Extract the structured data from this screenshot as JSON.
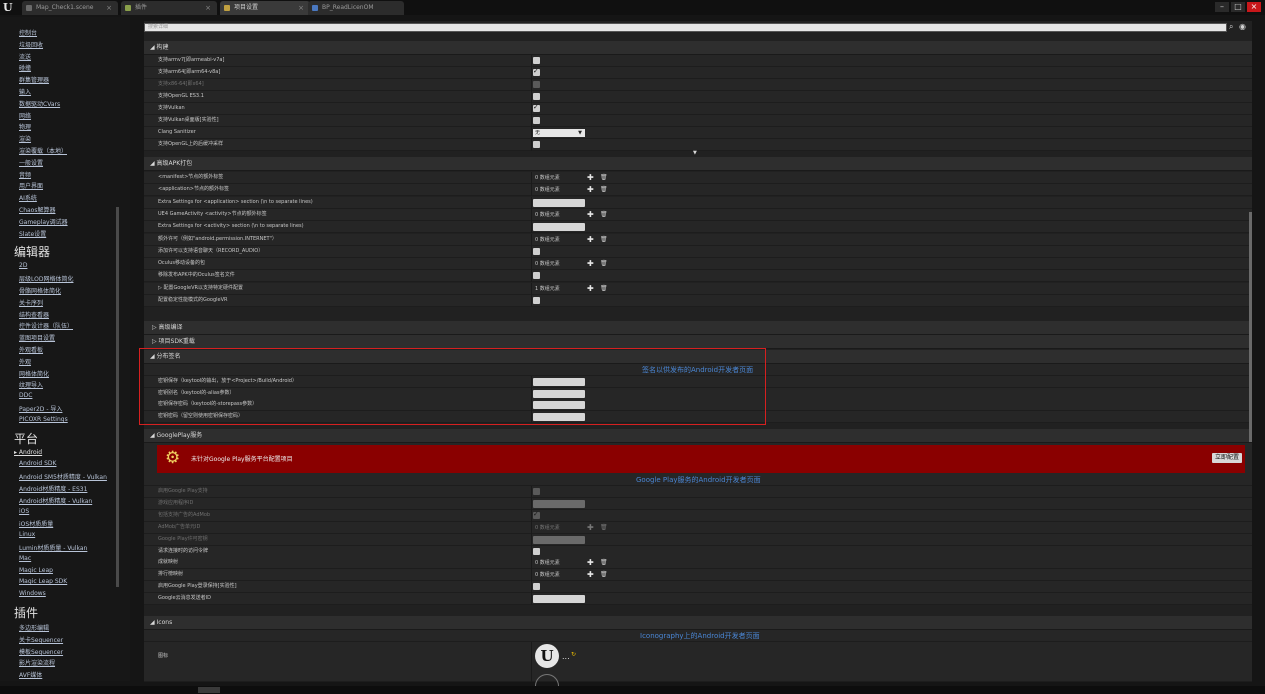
{
  "titlebar": {
    "tabs": [
      {
        "label": "Map_Check1.scene",
        "active": false
      },
      {
        "label": "插件",
        "active": false
      },
      {
        "label": "项目设置",
        "active": true
      },
      {
        "label": "BP_ReadLicenOM",
        "active": false
      }
    ],
    "close_glyph": "×",
    "win_min": "–",
    "win_max": "□",
    "win_close": "×"
  },
  "sidebar": {
    "items_engine": [
      "控制台",
      "垃圾回收",
      "流送",
      "碰撞",
      "群集管理器",
      "输入",
      "数据驱动CVars",
      "网络",
      "物理",
      "渲染",
      "渲染覆载（本地）",
      "一般设置",
      "音频",
      "用户界面",
      "AI系统",
      "Chaos解算器",
      "Gameplay调试器",
      "Slate设置"
    ],
    "section_editor": "编辑器",
    "items_editor": [
      "2D",
      "层级LOD网格体简化",
      "骨骼网格体简化",
      "关卡序列",
      "结构查看器",
      "控件设计器（队伍）",
      "蓝图项目设置",
      "外观看板",
      "外观",
      "网格体简化",
      "纹理导入",
      "DDC",
      "Paper2D - 导入",
      "PICOXR Settings"
    ],
    "section_platform": "平台",
    "items_platform": [
      "Android",
      "Android SDK",
      "Android SM5材质精度 - Vulkan",
      "Android材质精度 - ES31",
      "Android材质精度 - Vulkan",
      "iOS",
      "iOS材质质量",
      "Linux",
      "Lumin材质质量 - Vulkan",
      "Mac",
      "Magic Leap",
      "Magic Leap SDK",
      "Windows"
    ],
    "section_plugins": "插件",
    "items_plugins": [
      "多边形编辑",
      "关卡Sequencer",
      "模板Sequencer",
      "影片渲染流程",
      "AVF媒体"
    ]
  },
  "search": {
    "placeholder": "搜索详细"
  },
  "build": {
    "header": "构建",
    "rows": [
      {
        "label": "支持armv7[即armeabi-v7a]",
        "control": "checkbox",
        "checked": false,
        "dim": false
      },
      {
        "label": "支持arm64[即arm64-v8a]",
        "control": "checkbox",
        "checked": true,
        "dim": false
      },
      {
        "label": "支持x86-64[即x64]",
        "control": "checkbox",
        "checked": false,
        "dim": true
      },
      {
        "label": "支持OpenGL ES3.1",
        "control": "checkbox",
        "checked": false,
        "dim": false
      },
      {
        "label": "支持Vulkan",
        "control": "checkbox",
        "checked": true,
        "dim": false
      },
      {
        "label": "支持Vulkan桌面版[实验性]",
        "control": "checkbox",
        "checked": false,
        "dim": false
      },
      {
        "label": "Clang Sanitizer",
        "control": "dropdown",
        "value": "无",
        "dim": false
      },
      {
        "label": "支持OpenGL上的后缓冲采样",
        "control": "checkbox",
        "checked": false,
        "dim": false
      }
    ]
  },
  "apk": {
    "header": "高级APK打包",
    "rows": [
      {
        "label": "<manifest>节点的额外标签",
        "control": "array",
        "value": "0 数组元素"
      },
      {
        "label": "<application>节点的额外标签",
        "control": "array",
        "value": "0 数组元素"
      },
      {
        "label": "Extra Settings for <application> section (\\n to separate lines)",
        "control": "text"
      },
      {
        "label": "UE4 GameActivity <activity>节点的额外标签",
        "control": "array",
        "value": "0 数组元素"
      },
      {
        "label": "Extra Settings for <activity> section (\\n to separate lines)",
        "control": "text"
      },
      {
        "label": "额外许可（例如\"android.permission.INTERNET\"）",
        "control": "array",
        "value": "0 数组元素"
      },
      {
        "label": "添加许可以支持语音聊天（RECORD_AUDIO）",
        "control": "checkbox",
        "checked": false
      },
      {
        "label": "Oculus移动设备的包",
        "control": "array",
        "value": "0 数组元素"
      },
      {
        "label": "移除发布APK中的Oculus签名文件",
        "control": "checkbox",
        "checked": false
      },
      {
        "label": "配置GoogleVR以支持特定硬件配置",
        "control": "array",
        "value": "1 数组元素",
        "expander": true
      },
      {
        "label": "配置稳定性能模式的GoogleVR",
        "control": "checkbox",
        "checked": false
      }
    ]
  },
  "advanced_build": {
    "header": "高级编译"
  },
  "project_sdk": {
    "header": "项目SDK重载"
  },
  "distribution": {
    "header": "分布签名",
    "link": "签名以供发布的Android开发者页面",
    "rows": [
      {
        "label": "密钥保存（keytool的输出，放于<Project>/Build/Android）"
      },
      {
        "label": "密钥别名（keytool的-alias参数）"
      },
      {
        "label": "密钥保存密码（keytool的-storepass参数）"
      },
      {
        "label": "密钥密码（留空则使用密钥保存密码）"
      }
    ]
  },
  "googleplay": {
    "header": "GooglePlay服务",
    "banner_text": "未针对Google Play服务平台配置项目",
    "banner_button": "立即配置",
    "link": "Google Play服务的Android开发者页面",
    "rows": [
      {
        "label": "启用Google Play支持",
        "control": "checkbox",
        "checked": false,
        "dim": true
      },
      {
        "label": "游戏应用程序ID",
        "control": "text",
        "dim": true
      },
      {
        "label": "包括支持广告的AdMob",
        "control": "checkbox",
        "checked": true,
        "dim": true
      },
      {
        "label": "AdMob广告单元ID",
        "control": "array",
        "value": "0 数组元素",
        "dim": true
      },
      {
        "label": "Google Play许可密钥",
        "control": "text",
        "dim": true
      },
      {
        "label": "请求连接时的访问令牌",
        "control": "checkbox",
        "checked": false,
        "dim": false
      },
      {
        "label": "成就映射",
        "control": "array",
        "value": "0 数组元素",
        "dim": false
      },
      {
        "label": "排行榜映射",
        "control": "array",
        "value": "0 数组元素",
        "dim": false
      },
      {
        "label": "启用Google Play登录保持[实验性]",
        "control": "checkbox",
        "checked": false,
        "dim": false
      },
      {
        "label": "Google云消息发送者ID",
        "control": "text",
        "dim": false
      }
    ]
  },
  "icons": {
    "header": "Icons",
    "link": "Iconography上的Android开发者页面",
    "icon_label": "图标",
    "ellipsis": "...",
    "refresh_glyph": "↻"
  },
  "glyphs": {
    "plus": "✚",
    "trash": "🗑",
    "caret": "▼",
    "expander": "▷",
    "collapse": "◢",
    "search": "⌕",
    "eye": "◉"
  },
  "colors": {
    "link": "#4a86d4",
    "banner": "#8a0000",
    "highlight": "#d62020"
  }
}
